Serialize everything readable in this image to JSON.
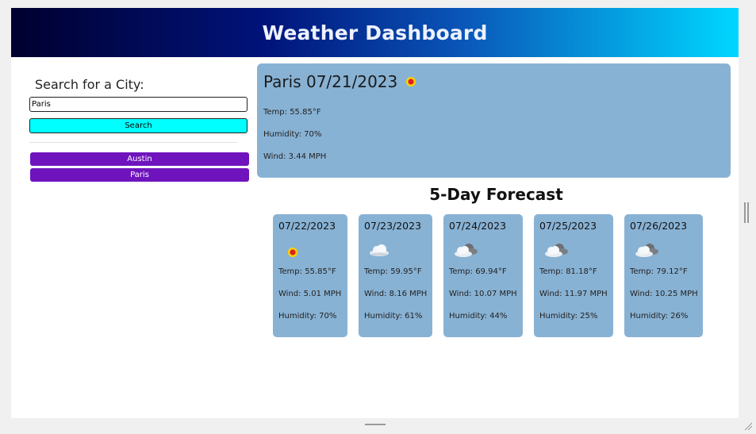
{
  "header": {
    "title": "Weather Dashboard"
  },
  "sidebar": {
    "heading": "Search for a City:",
    "search_value": "Paris",
    "search_button": "Search",
    "history": [
      "Austin",
      "Paris"
    ]
  },
  "current": {
    "title": "Paris 07/21/2023",
    "icon": "sun-icon",
    "temp": "Temp: 55.85°F",
    "humidity": "Humidity: 70%",
    "wind": "Wind: 3.44 MPH"
  },
  "forecast": {
    "heading": "5-Day Forecast",
    "days": [
      {
        "date": "07/22/2023",
        "icon": "sun-icon",
        "temp": "Temp: 55.85°F",
        "wind": "Wind: 5.01 MPH",
        "humidity": "Humidity: 70%"
      },
      {
        "date": "07/23/2023",
        "icon": "cloud-icon",
        "temp": "Temp: 59.95°F",
        "wind": "Wind: 8.16 MPH",
        "humidity": "Humidity: 61%"
      },
      {
        "date": "07/24/2023",
        "icon": "broken-clouds-icon",
        "temp": "Temp: 69.94°F",
        "wind": "Wind: 10.07 MPH",
        "humidity": "Humidity: 44%"
      },
      {
        "date": "07/25/2023",
        "icon": "broken-clouds-icon",
        "temp": "Temp: 81.18°F",
        "wind": "Wind: 11.97 MPH",
        "humidity": "Humidity: 25%"
      },
      {
        "date": "07/26/2023",
        "icon": "broken-clouds-icon",
        "temp": "Temp: 79.12°F",
        "wind": "Wind: 10.25 MPH",
        "humidity": "Humidity: 26%"
      }
    ]
  },
  "colors": {
    "header_gradient": [
      "#00002f",
      "#00137a",
      "#0a56b8",
      "#00d7ff"
    ],
    "card_bg": "#88b2d4",
    "search_button_bg": "#00ffff",
    "history_button_bg": "#6f14bd"
  }
}
